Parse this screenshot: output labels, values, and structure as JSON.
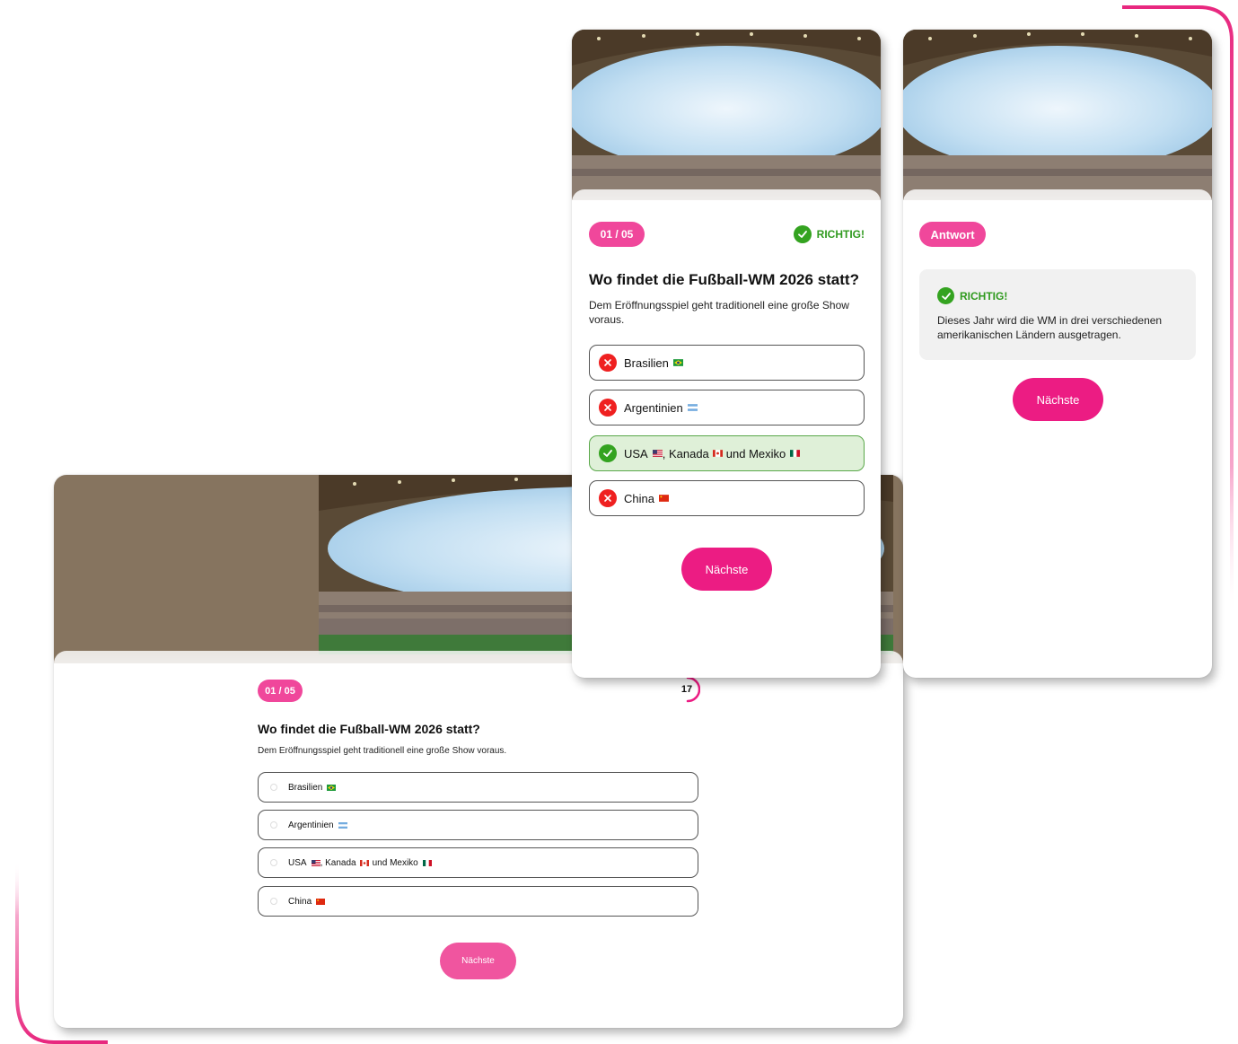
{
  "brand_color": "#ec1c83",
  "accent_light": "#f0479b",
  "success_color": "#34a320",
  "error_color": "#ef2020",
  "desktop": {
    "progress": "01 / 05",
    "timer": "17",
    "question": "Wo findet die Fußball-WM 2026 statt?",
    "subtitle": "Dem Eröffnungsspiel geht traditionell eine große Show voraus.",
    "options": [
      "Brasilien",
      "Argentinien",
      "USA",
      "China"
    ],
    "option3_parts": [
      ", Kanada",
      "und Mexiko"
    ],
    "next_label": "Nächste"
  },
  "mobile_question": {
    "progress": "01 / 05",
    "status": "RICHTIG!",
    "question": "Wo findet die Fußball-WM 2026 statt?",
    "subtitle": "Dem Eröffnungsspiel geht traditionell eine große Show voraus.",
    "options": [
      "Brasilien",
      "Argentinien",
      "USA",
      "China"
    ],
    "option3_parts": [
      ", Kanada",
      "und Mexiko"
    ],
    "option_states": [
      "wrong",
      "wrong",
      "correct",
      "wrong"
    ],
    "next_label": "Nächste"
  },
  "mobile_answer": {
    "badge": "Antwort",
    "status": "RICHTIG!",
    "explanation": "Dieses Jahr wird die WM in drei verschiedenen amerikanischen Ländern ausgetragen.",
    "next_label": "Nächste"
  },
  "icons": {
    "correct": "check-circle-icon",
    "wrong": "x-circle-icon",
    "flags": [
      "flag-brazil-icon",
      "flag-argentina-icon",
      "flag-usa-icon",
      "flag-canada-icon",
      "flag-mexico-icon",
      "flag-china-icon"
    ]
  }
}
